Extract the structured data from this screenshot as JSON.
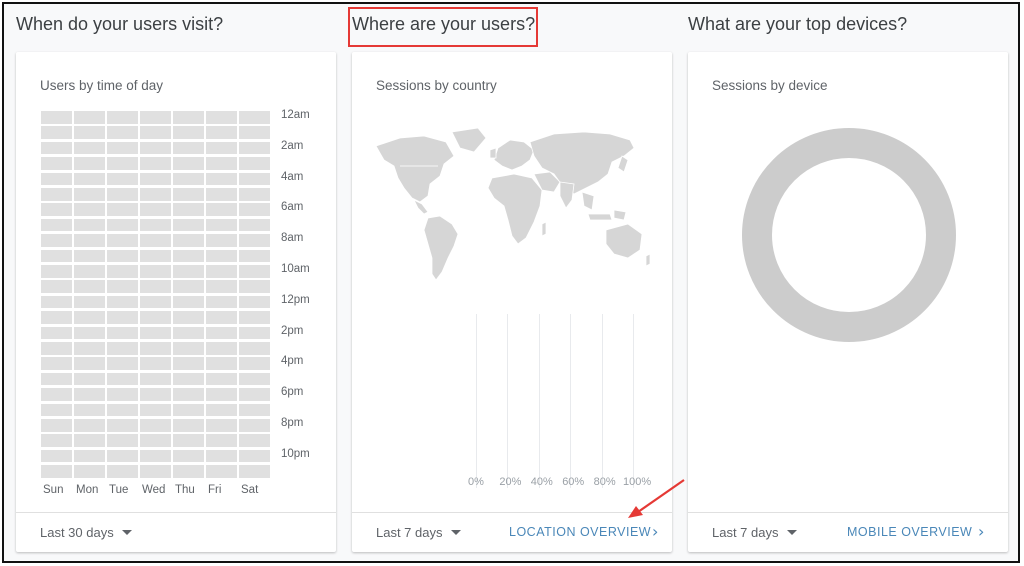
{
  "sections": [
    {
      "title": "When do your users visit?",
      "card": {
        "title": "Users by time of day",
        "hours": [
          "12am",
          "2am",
          "4am",
          "6am",
          "8am",
          "10am",
          "12pm",
          "2pm",
          "4pm",
          "6pm",
          "8pm",
          "10pm"
        ],
        "days": [
          "Sun",
          "Mon",
          "Tue",
          "Wed",
          "Thu",
          "Fri",
          "Sat"
        ],
        "range": "Last 30 days"
      }
    },
    {
      "title": "Where are your users?",
      "card": {
        "title": "Sessions by country",
        "percent_ticks": [
          "0%",
          "20%",
          "40%",
          "60%",
          "80%",
          "100%"
        ],
        "range": "Last 7 days",
        "link": "LOCATION OVERVIEW"
      }
    },
    {
      "title": "What are your top devices?",
      "card": {
        "title": "Sessions by device",
        "range": "Last 7 days",
        "link": "MOBILE OVERVIEW"
      }
    }
  ],
  "colors": {
    "highlight": "#e53935",
    "link": "#4a87b8",
    "heat_cell": "#e0e0e0",
    "map_land": "#d6d6d6",
    "donut": "#cccccc"
  },
  "icons": {
    "dropdown": "caret-down-icon",
    "link_arrow": "chevron-right-icon",
    "annotation": "red-arrow-icon"
  }
}
